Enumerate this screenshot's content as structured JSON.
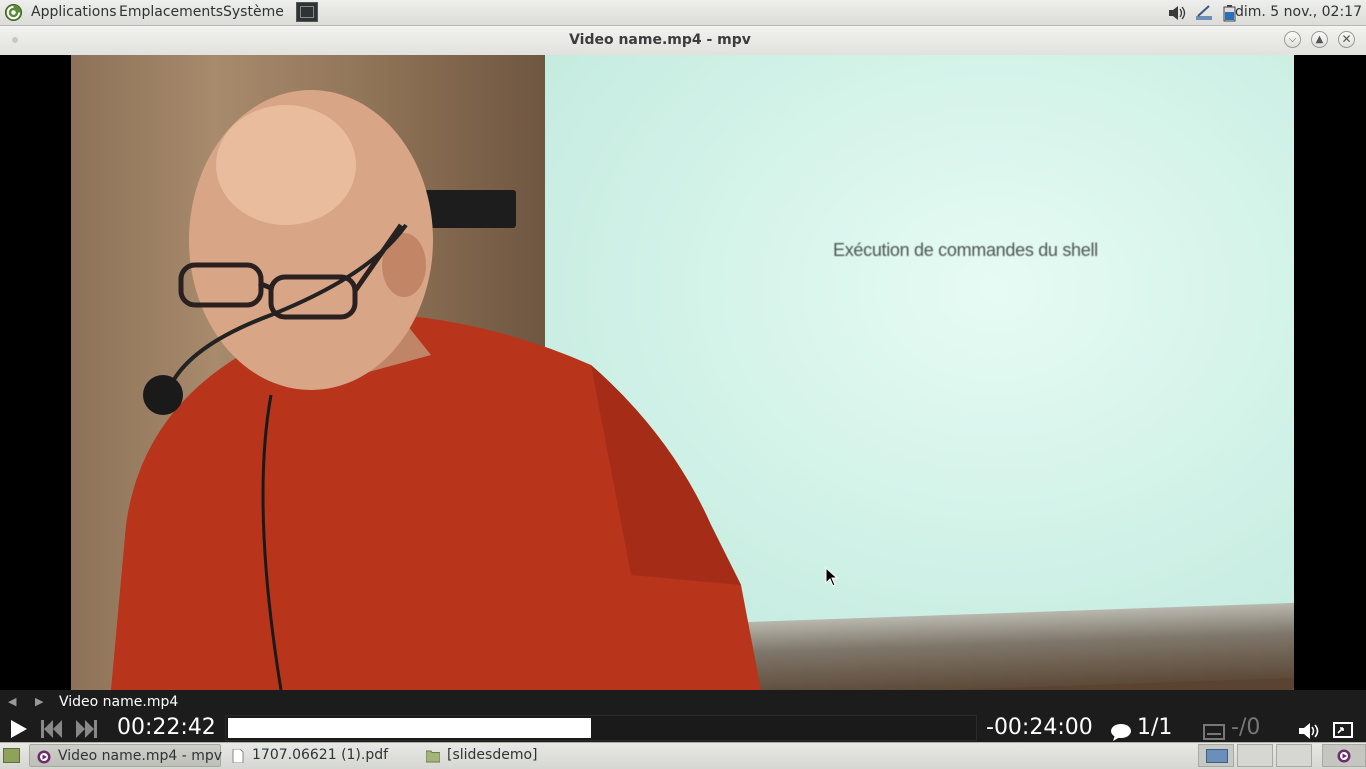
{
  "top_panel": {
    "menus": [
      "Applications",
      "Emplacements",
      "Système"
    ],
    "clock": "dim.  5 nov., 02:17",
    "tray_icons": [
      "volume-icon",
      "network-icon",
      "battery-icon"
    ]
  },
  "window": {
    "title": "Video name.mp4 - mpv",
    "buttons": [
      "minimize",
      "maximize",
      "close"
    ]
  },
  "video": {
    "slide_text": "Exécution de commandes du shell"
  },
  "player": {
    "playlist_title": "Video name.mp4",
    "time_elapsed": "00:22:42",
    "time_remaining": "-00:24:00",
    "progress": 0.486,
    "subtitle_tracks": "1/1",
    "audio_tracks": "-/0",
    "colors": {
      "osc_bg": "#1e1e1e",
      "text": "#ffffff",
      "fill": "#ffffff"
    }
  },
  "taskbar": {
    "tasks": [
      {
        "label": "Video name.mp4 - mpv",
        "icon": "mpv-icon",
        "active": true
      },
      {
        "label": "1707.06621 (1).pdf",
        "icon": "document-icon",
        "active": false
      },
      {
        "label": "[slidesdemo]",
        "icon": "folder-icon",
        "active": false
      }
    ]
  }
}
